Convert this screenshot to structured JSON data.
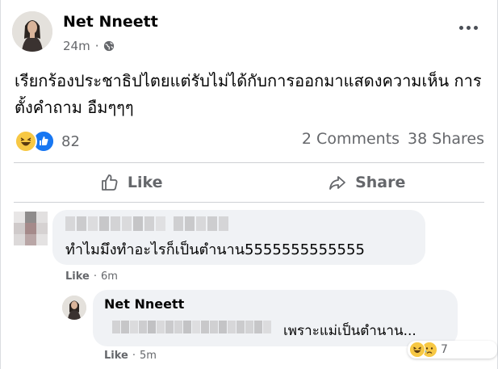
{
  "post": {
    "author": "Net Nneett",
    "time": "24m",
    "separator": "·",
    "text": "เรียกร้องประชาธิปไตยแต่รับไม่ได้กับการออกมาแสดงความเห็น การตั้งคำถาม อืมๆๆๆ",
    "reaction_count": "82",
    "comments_count": "2 Comments",
    "shares_count": "38 Shares",
    "reaction_icons": [
      "haha-icon",
      "like-icon"
    ]
  },
  "actions": {
    "like_label": "Like",
    "share_label": "Share"
  },
  "comment": {
    "text": "ทำไมมึงทำอะไรก็เป็นตำนาน5555555555555",
    "like_label": "Like",
    "separator": "·",
    "time": "6m"
  },
  "reply": {
    "author": "Net Nneett",
    "text": "เพราะแม่เป็นตำนาน...",
    "like_label": "Like",
    "separator": "·",
    "time": "5m",
    "reaction_count": "7",
    "reaction_icons": [
      "haha-icon",
      "sad-icon"
    ]
  },
  "colors": {
    "secondary_text": "#65676b",
    "bubble_bg": "#f0f2f5",
    "like_blue": "#1877f2",
    "haha_yellow": "#f7c844"
  }
}
